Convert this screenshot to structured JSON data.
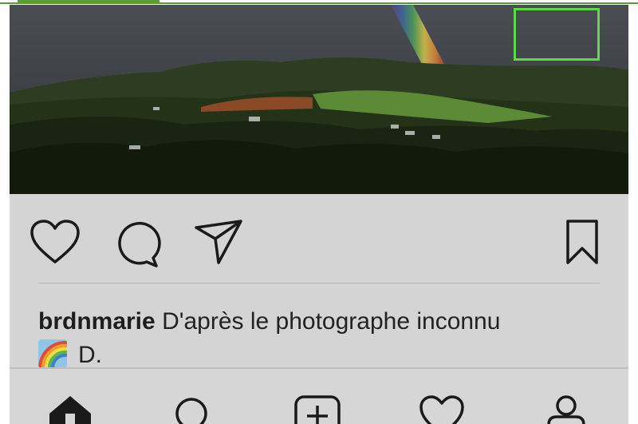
{
  "post": {
    "username": "brdnmarie",
    "caption_text": "D'après le photographe inconnu",
    "caption_end": "D."
  },
  "icons": {
    "like": "heart-icon",
    "comment": "comment-bubble-icon",
    "share": "paper-plane-icon",
    "save": "bookmark-icon",
    "emoji": "rainbow-emoji"
  },
  "nav": {
    "items": [
      {
        "name": "home-icon"
      },
      {
        "name": "search-icon"
      },
      {
        "name": "new-post-icon"
      },
      {
        "name": "activity-heart-icon"
      },
      {
        "name": "profile-icon",
        "highlighted": true
      }
    ]
  },
  "colors": {
    "highlight": "#5bdc45",
    "top_accent": "#5a9a3c",
    "background": "#d4d4d4"
  }
}
